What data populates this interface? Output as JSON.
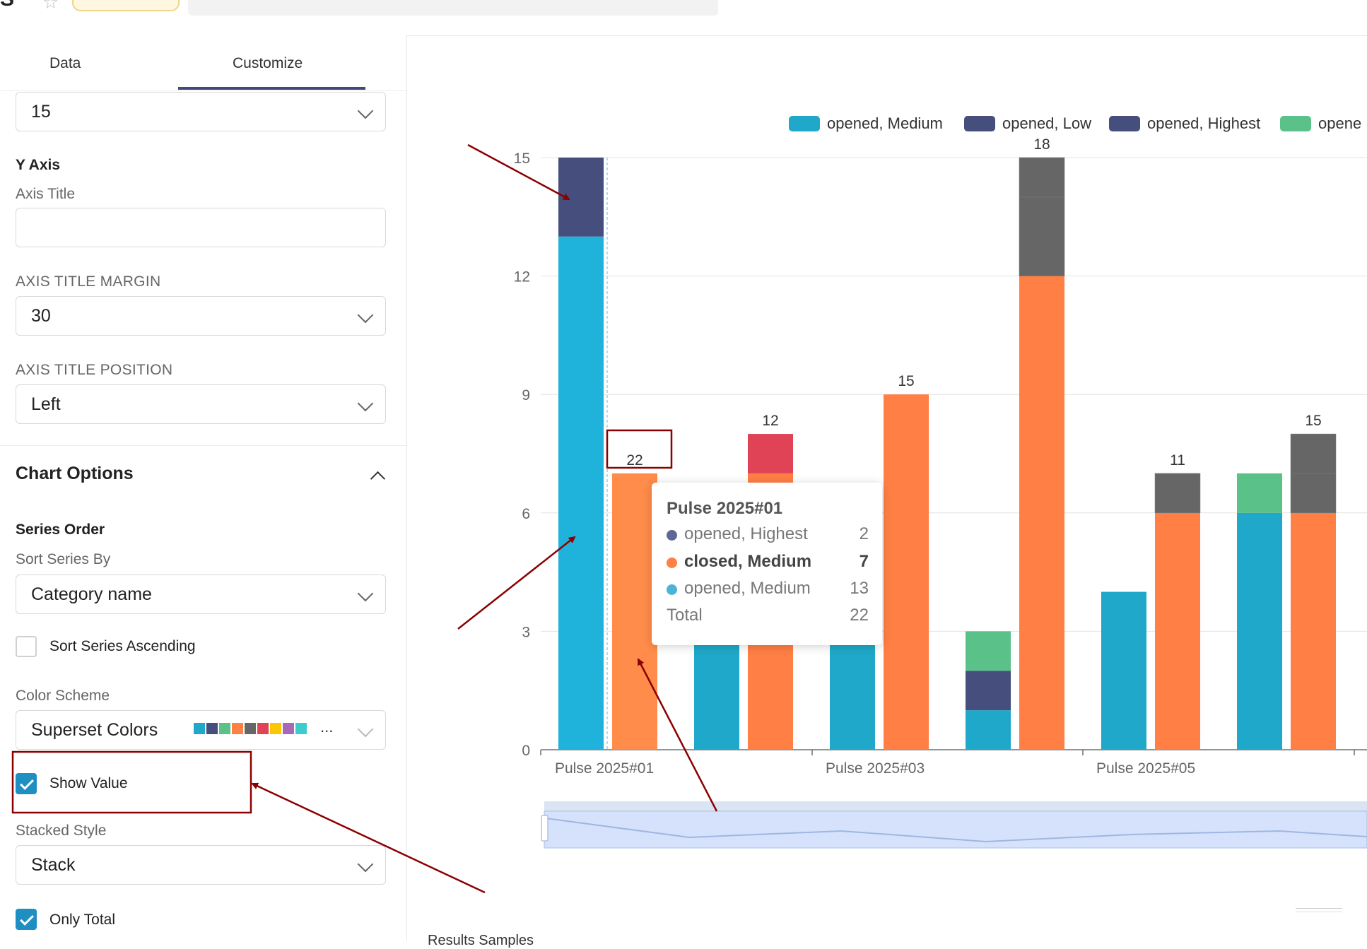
{
  "left_panel": {
    "tabs": [
      {
        "label": "Data",
        "active": false
      },
      {
        "label": "Customize",
        "active": true
      }
    ],
    "top_select_value": "15",
    "y_axis": {
      "heading": "Y Axis",
      "axis_title_label": "Axis Title",
      "axis_title_value": "",
      "margin_label": "AXIS TITLE MARGIN",
      "margin_value": "30",
      "position_label": "AXIS TITLE POSITION",
      "position_value": "Left"
    },
    "chart_options": {
      "title": "Chart Options",
      "series_order_heading": "Series Order",
      "sort_by_label": "Sort Series By",
      "sort_by_value": "Category name",
      "sort_ascending_label": "Sort Series Ascending",
      "sort_ascending_checked": false,
      "color_scheme_label": "Color Scheme",
      "color_scheme_value": "Superset Colors",
      "color_scheme_swatches": [
        "#1FA8C9",
        "#454E7C",
        "#5AC189",
        "#FF7F44",
        "#666666",
        "#E04355",
        "#FCC700",
        "#A868B7",
        "#3CCCCB"
      ],
      "color_scheme_more": "...",
      "show_value_label": "Show Value",
      "show_value_checked": true,
      "stacked_style_label": "Stacked Style",
      "stacked_style_value": "Stack",
      "only_total_label": "Only Total",
      "only_total_checked": true
    }
  },
  "chart_data": {
    "type": "bar",
    "stacked": true,
    "legend": [
      {
        "name": "opened, Medium",
        "color": "#1FA8C9"
      },
      {
        "name": "opened, Low",
        "color": "#454E7C"
      },
      {
        "name": "opened, Highest",
        "color": "#454E7C"
      },
      {
        "name": "opene",
        "color": "#5AC189"
      }
    ],
    "legend_position": "top",
    "x_tick_labels": [
      "Pulse 2025#01",
      "Pulse 2025#03",
      "Pulse 2025#05"
    ],
    "y_ticks": [
      0,
      3,
      6,
      9,
      12,
      15
    ],
    "ylim": [
      0,
      15
    ],
    "grid": true,
    "bars": [
      {
        "segments": [
          {
            "value": 13,
            "color": "#1FB3DC"
          },
          {
            "value": 2,
            "color": "#454E7C"
          }
        ],
        "total_label": ""
      },
      {
        "segments": [
          {
            "value": 7,
            "color": "#FF8C4A"
          }
        ],
        "total_label": "22"
      },
      {
        "segments": [
          {
            "value": 3,
            "color": "#1FA8C9"
          }
        ],
        "total_label": ""
      },
      {
        "segments": [
          {
            "value": 7,
            "color": "#FF7F44"
          },
          {
            "value": 1,
            "color": "#E04355"
          }
        ],
        "total_label": "12"
      },
      {
        "segments": [
          {
            "value": 3,
            "color": "#1FA8C9"
          }
        ],
        "total_label": ""
      },
      {
        "segments": [
          {
            "value": 9,
            "color": "#FF7F44"
          }
        ],
        "total_label": "15"
      },
      {
        "segments": [
          {
            "value": 1,
            "color": "#1FA8C9"
          },
          {
            "value": 1,
            "color": "#454E7C"
          },
          {
            "value": 1,
            "color": "#5AC189"
          }
        ],
        "total_label": ""
      },
      {
        "segments": [
          {
            "value": 12,
            "color": "#FF7F44"
          },
          {
            "value": 2,
            "color": "#666666"
          },
          {
            "value": 1,
            "color": "#666666"
          }
        ],
        "total_label": "18"
      },
      {
        "segments": [
          {
            "value": 4,
            "color": "#1FA8C9"
          }
        ],
        "total_label": ""
      },
      {
        "segments": [
          {
            "value": 6,
            "color": "#FF7F44"
          },
          {
            "value": 1,
            "color": "#666666"
          }
        ],
        "total_label": "11"
      },
      {
        "segments": [
          {
            "value": 6,
            "color": "#1FA8C9"
          },
          {
            "value": 1,
            "color": "#5AC189"
          }
        ],
        "total_label": ""
      },
      {
        "segments": [
          {
            "value": 6,
            "color": "#FF7F44"
          },
          {
            "value": 1,
            "color": "#666666"
          },
          {
            "value": 1,
            "color": "#666666"
          }
        ],
        "total_label": "15"
      }
    ]
  },
  "tooltip": {
    "title": "Pulse 2025#01",
    "rows": [
      {
        "name": "opened, Highest",
        "value": "2",
        "color": "#5F6795",
        "bold": false
      },
      {
        "name": "closed, Medium",
        "value": "7",
        "color": "#FF7F44",
        "bold": true
      },
      {
        "name": "opened, Medium",
        "value": "13",
        "color": "#4BB3D7",
        "bold": false
      }
    ],
    "total_label": "Total",
    "total_value": "22"
  },
  "footer": {
    "results_text": "Results Samples"
  },
  "annotation_color": "#8B0000"
}
